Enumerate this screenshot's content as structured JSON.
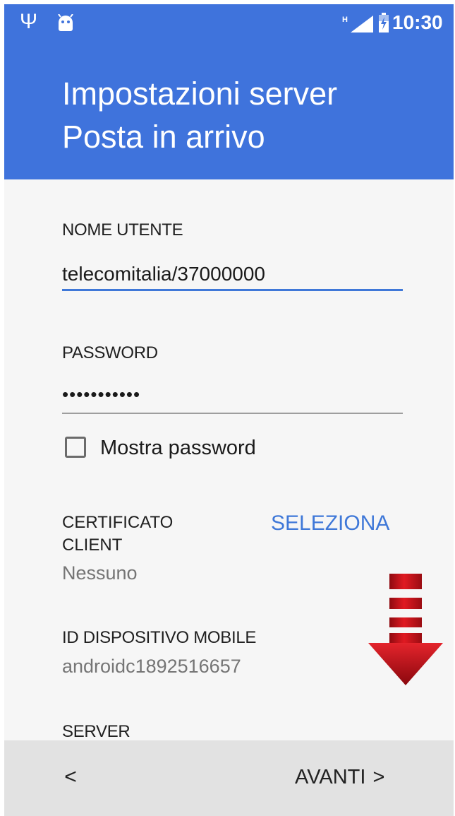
{
  "status_bar": {
    "time": "10:30",
    "network_type": "H",
    "icons": [
      "usb-icon",
      "android-icon",
      "signal-icon",
      "battery-charging-icon"
    ]
  },
  "header": {
    "title_line1": "Impostazioni server",
    "title_line2": "Posta in arrivo",
    "color": "#3f73dc"
  },
  "form": {
    "username_label": "NOME UTENTE",
    "username_value": "telecomitalia/37000000",
    "password_label": "PASSWORD",
    "password_value": "•••••••••••",
    "show_password_label": "Mostra password",
    "show_password_checked": false,
    "client_cert_label_line1": "CERTIFICATO",
    "client_cert_label_line2": "CLIENT",
    "client_cert_value": "Nessuno",
    "select_button_label": "SELEZIONA",
    "device_id_label": "ID DISPOSITIVO MOBILE",
    "device_id_value": "androidc1892516657",
    "server_label": "SERVER"
  },
  "bottom_bar": {
    "back_label": "<",
    "next_label": "AVANTI",
    "next_chevron": ">"
  },
  "colors": {
    "accent": "#3f78d8",
    "focused_underline": "#3f78d8",
    "annotation_arrow": "#c8101a"
  },
  "annotation": {
    "icon": "down-arrow-icon"
  }
}
